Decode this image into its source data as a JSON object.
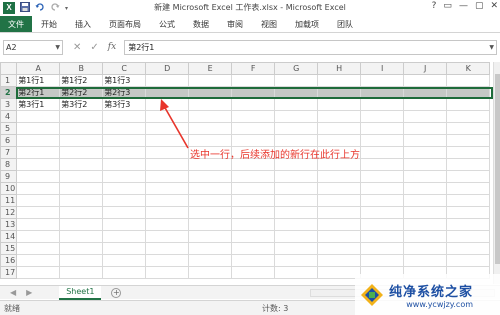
{
  "titlebar": {
    "title": "新建 Microsoft Excel 工作表.xlsx - Microsoft Excel",
    "app_icon": "X",
    "qat": [
      "save-icon",
      "undo-icon",
      "redo-icon"
    ],
    "window_controls": [
      "?",
      "▭",
      "—",
      "▢",
      "✕"
    ]
  },
  "ribbon": {
    "file_label": "文件",
    "tabs": [
      "开始",
      "插入",
      "页面布局",
      "公式",
      "数据",
      "审阅",
      "视图",
      "加载项",
      "团队"
    ]
  },
  "formula_bar": {
    "name_box": "A2",
    "cancel": "✕",
    "confirm": "✓",
    "fx": "fx",
    "content": "第2行1"
  },
  "grid": {
    "columns": [
      "A",
      "B",
      "C",
      "D",
      "E",
      "F",
      "G",
      "H",
      "I",
      "J",
      "K"
    ],
    "rows": [
      {
        "num": "1",
        "cells": [
          "第1行1",
          "第1行2",
          "第1行3",
          "",
          "",
          "",
          "",
          "",
          "",
          "",
          ""
        ]
      },
      {
        "num": "2",
        "cells": [
          "第2行1",
          "第2行2",
          "第2行3",
          "",
          "",
          "",
          "",
          "",
          "",
          "",
          ""
        ]
      },
      {
        "num": "3",
        "cells": [
          "第3行1",
          "第3行2",
          "第3行3",
          "",
          "",
          "",
          "",
          "",
          "",
          "",
          ""
        ]
      },
      {
        "num": "4",
        "cells": [
          "",
          "",
          "",
          "",
          "",
          "",
          "",
          "",
          "",
          "",
          ""
        ]
      },
      {
        "num": "5",
        "cells": [
          "",
          "",
          "",
          "",
          "",
          "",
          "",
          "",
          "",
          "",
          ""
        ]
      },
      {
        "num": "6",
        "cells": [
          "",
          "",
          "",
          "",
          "",
          "",
          "",
          "",
          "",
          "",
          ""
        ]
      },
      {
        "num": "7",
        "cells": [
          "",
          "",
          "",
          "",
          "",
          "",
          "",
          "",
          "",
          "",
          ""
        ]
      },
      {
        "num": "8",
        "cells": [
          "",
          "",
          "",
          "",
          "",
          "",
          "",
          "",
          "",
          "",
          ""
        ]
      },
      {
        "num": "9",
        "cells": [
          "",
          "",
          "",
          "",
          "",
          "",
          "",
          "",
          "",
          "",
          ""
        ]
      },
      {
        "num": "10",
        "cells": [
          "",
          "",
          "",
          "",
          "",
          "",
          "",
          "",
          "",
          "",
          ""
        ]
      },
      {
        "num": "11",
        "cells": [
          "",
          "",
          "",
          "",
          "",
          "",
          "",
          "",
          "",
          "",
          ""
        ]
      },
      {
        "num": "12",
        "cells": [
          "",
          "",
          "",
          "",
          "",
          "",
          "",
          "",
          "",
          "",
          ""
        ]
      },
      {
        "num": "13",
        "cells": [
          "",
          "",
          "",
          "",
          "",
          "",
          "",
          "",
          "",
          "",
          ""
        ]
      },
      {
        "num": "14",
        "cells": [
          "",
          "",
          "",
          "",
          "",
          "",
          "",
          "",
          "",
          "",
          ""
        ]
      },
      {
        "num": "15",
        "cells": [
          "",
          "",
          "",
          "",
          "",
          "",
          "",
          "",
          "",
          "",
          ""
        ]
      },
      {
        "num": "16",
        "cells": [
          "",
          "",
          "",
          "",
          "",
          "",
          "",
          "",
          "",
          "",
          ""
        ]
      },
      {
        "num": "17",
        "cells": [
          "",
          "",
          "",
          "",
          "",
          "",
          "",
          "",
          "",
          "",
          ""
        ]
      }
    ],
    "selected_row": "2"
  },
  "sheets": {
    "nav_prev": "◀",
    "nav_next": "▶",
    "tabs": [
      "Sheet1"
    ],
    "add": "+"
  },
  "statusbar": {
    "ready": "就绪",
    "count": "计数: 3"
  },
  "annotation": {
    "text": "选中一行，后续添加的新行在此行上方",
    "color": "#e8352b"
  },
  "watermark": {
    "name": "纯净系统之家",
    "url": "www.ycwjzy.com"
  },
  "colors": {
    "excel_green": "#217346",
    "selection_fill": "#c5c8c5"
  }
}
